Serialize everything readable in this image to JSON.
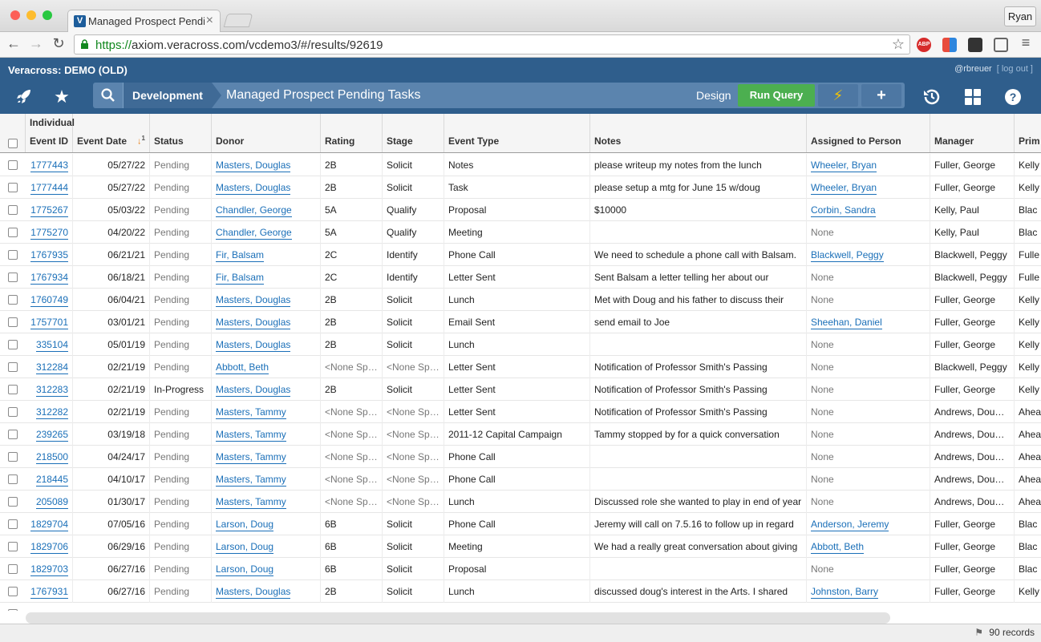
{
  "browser": {
    "tab_title": "Managed Prospect Pending",
    "tab_favicon": "V",
    "url_scheme": "https://",
    "url_rest": "axiom.veracross.com/vcdemo3/#/results/92619",
    "user_button": "Ryan",
    "ext_abp": "ABP"
  },
  "app": {
    "brand": "Veracross: DEMO (OLD)",
    "username": "@rbreuer",
    "logout": "[ log out ]",
    "breadcrumb_module": "Development",
    "page_title": "Managed Prospect Pending Tasks",
    "design_label": "Design",
    "run_query_label": "Run Query"
  },
  "table": {
    "group_header": "Individual",
    "sort_indicator": "1",
    "columns": [
      "Event ID",
      "Event Date",
      "Status",
      "Donor",
      "Rating",
      "Stage",
      "Event Type",
      "Notes",
      "Assigned to Person",
      "Manager",
      "Prim"
    ],
    "rows": [
      [
        "1777443",
        "05/27/22",
        "Pending",
        "Masters, Douglas",
        "2B",
        "Solicit",
        "Notes",
        "please writeup my notes from the lunch",
        "Wheeler, Bryan",
        "Fuller, George",
        "Kelly"
      ],
      [
        "1777444",
        "05/27/22",
        "Pending",
        "Masters, Douglas",
        "2B",
        "Solicit",
        "Task",
        "please setup a mtg for June 15 w/doug",
        "Wheeler, Bryan",
        "Fuller, George",
        "Kelly"
      ],
      [
        "1775267",
        "05/03/22",
        "Pending",
        "Chandler, George",
        "5A",
        "Qualify",
        "Proposal",
        "$10000",
        "Corbin, Sandra",
        "Kelly, Paul",
        "Blac"
      ],
      [
        "1775270",
        "04/20/22",
        "Pending",
        "Chandler, George",
        "5A",
        "Qualify",
        "Meeting",
        "",
        "None",
        "Kelly, Paul",
        "Blac"
      ],
      [
        "1767935",
        "06/21/21",
        "Pending",
        "Fir, Balsam",
        "2C",
        "Identify",
        "Phone Call",
        "We need to schedule a phone call with Balsam.",
        "Blackwell, Peggy",
        "Blackwell, Peggy",
        "Fulle"
      ],
      [
        "1767934",
        "06/18/21",
        "Pending",
        "Fir, Balsam",
        "2C",
        "Identify",
        "Letter Sent",
        "Sent Balsam a letter telling her about our",
        "None",
        "Blackwell, Peggy",
        "Fulle"
      ],
      [
        "1760749",
        "06/04/21",
        "Pending",
        "Masters, Douglas",
        "2B",
        "Solicit",
        "Lunch",
        "Met with Doug and his father to discuss their",
        "None",
        "Fuller, George",
        "Kelly"
      ],
      [
        "1757701",
        "03/01/21",
        "Pending",
        "Masters, Douglas",
        "2B",
        "Solicit",
        "Email Sent",
        "send email to Joe",
        "Sheehan, Daniel",
        "Fuller, George",
        "Kelly"
      ],
      [
        "335104",
        "05/01/19",
        "Pending",
        "Masters, Douglas",
        "2B",
        "Solicit",
        "Lunch",
        "",
        "None",
        "Fuller, George",
        "Kelly"
      ],
      [
        "312284",
        "02/21/19",
        "Pending",
        "Abbott, Beth",
        "<None Spe…",
        "<None Spe…",
        "Letter Sent",
        "Notification of Professor Smith's Passing",
        "None",
        "Blackwell, Peggy",
        "Kelly"
      ],
      [
        "312283",
        "02/21/19",
        "In-Progress",
        "Masters, Douglas",
        "2B",
        "Solicit",
        "Letter Sent",
        "Notification of Professor Smith's Passing",
        "None",
        "Fuller, George",
        "Kelly"
      ],
      [
        "312282",
        "02/21/19",
        "Pending",
        "Masters, Tammy",
        "<None Spe…",
        "<None Spe…",
        "Letter Sent",
        "Notification of Professor Smith's Passing",
        "None",
        "Andrews, Dougl…",
        "Ahea"
      ],
      [
        "239265",
        "03/19/18",
        "Pending",
        "Masters, Tammy",
        "<None Spe…",
        "<None Spe…",
        "2011-12 Capital Campaign",
        "Tammy stopped by for a quick conversation",
        "None",
        "Andrews, Dougl…",
        "Ahea"
      ],
      [
        "218500",
        "04/24/17",
        "Pending",
        "Masters, Tammy",
        "<None Spe…",
        "<None Spe…",
        "Phone Call",
        "",
        "None",
        "Andrews, Dougl…",
        "Ahea"
      ],
      [
        "218445",
        "04/10/17",
        "Pending",
        "Masters, Tammy",
        "<None Spe…",
        "<None Spe…",
        "Phone Call",
        "",
        "None",
        "Andrews, Dougl…",
        "Ahea"
      ],
      [
        "205089",
        "01/30/17",
        "Pending",
        "Masters, Tammy",
        "<None Spe…",
        "<None Spe…",
        "Lunch",
        "Discussed role she wanted to play in end of year",
        "None",
        "Andrews, Dougl…",
        "Ahea"
      ],
      [
        "1829704",
        "07/05/16",
        "Pending",
        "Larson, Doug",
        "6B",
        "Solicit",
        "Phone Call",
        "Jeremy will call on 7.5.16 to follow up in regard",
        "Anderson, Jeremy",
        "Fuller, George",
        "Blac"
      ],
      [
        "1829706",
        "06/29/16",
        "Pending",
        "Larson, Doug",
        "6B",
        "Solicit",
        "Meeting",
        "We had a really great conversation about giving",
        "Abbott, Beth",
        "Fuller, George",
        "Blac"
      ],
      [
        "1829703",
        "06/27/16",
        "Pending",
        "Larson, Doug",
        "6B",
        "Solicit",
        "Proposal",
        "",
        "None",
        "Fuller, George",
        "Blac"
      ],
      [
        "1767931",
        "06/27/16",
        "Pending",
        "Masters, Douglas",
        "2B",
        "Solicit",
        "Lunch",
        "discussed doug's interest in the Arts. I shared",
        "Johnston, Barry",
        "Fuller, George",
        "Kelly"
      ]
    ]
  },
  "footer": {
    "record_count": "90 records"
  },
  "colors": {
    "header_bg": "#2f5e8c",
    "run_query": "#4caf50",
    "link": "#1a6fb8"
  }
}
